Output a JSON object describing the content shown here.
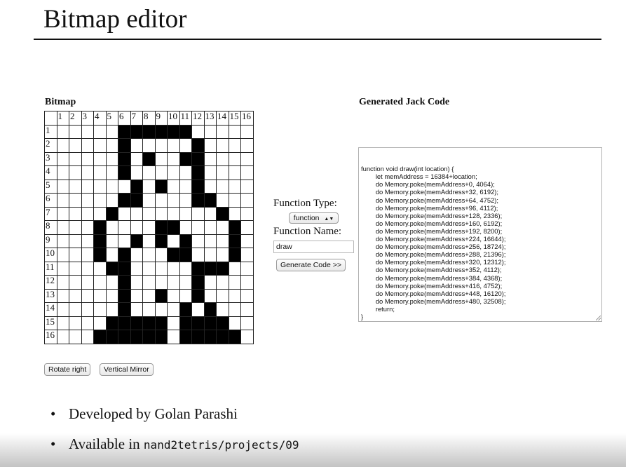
{
  "slide": {
    "title": "Bitmap editor"
  },
  "bitmap": {
    "label": "Bitmap",
    "column_headers": [
      "1",
      "2",
      "3",
      "4",
      "5",
      "6",
      "7",
      "8",
      "9",
      "10",
      "11",
      "12",
      "13",
      "14",
      "15",
      "16"
    ],
    "row_headers": [
      "1",
      "2",
      "3",
      "4",
      "5",
      "6",
      "7",
      "8",
      "9",
      "10",
      "11",
      "12",
      "13",
      "14",
      "15",
      "16"
    ],
    "rows": [
      "0000011111100000",
      "0000010000010000",
      "0000010100110000",
      "0000010000010000",
      "0000001010010000",
      "0000011000011000",
      "0000100000000100",
      "0001000011000010",
      "0001001010100010",
      "0001010001100010",
      "0000110000011100",
      "0000010000010000",
      "0000010010010000",
      "0000010000101000",
      "0000111110111100",
      "0001111110111110"
    ],
    "rotate_label": "Rotate right",
    "mirror_label": "Vertical Mirror"
  },
  "controls": {
    "function_type_label": "Function Type:",
    "function_type_value": "function",
    "function_name_label": "Function Name:",
    "function_name_value": "draw",
    "generate_label": "Generate Code >>"
  },
  "code": {
    "label": "Generated Jack Code",
    "lines": [
      "function void draw(int location) {",
      "\tlet memAddress = 16384+location;",
      "\tdo Memory.poke(memAddress+0, 4064);",
      "\tdo Memory.poke(memAddress+32, 6192);",
      "\tdo Memory.poke(memAddress+64, 4752);",
      "\tdo Memory.poke(memAddress+96, 4112);",
      "\tdo Memory.poke(memAddress+128, 2336);",
      "\tdo Memory.poke(memAddress+160, 6192);",
      "\tdo Memory.poke(memAddress+192, 8200);",
      "\tdo Memory.poke(memAddress+224, 16644);",
      "\tdo Memory.poke(memAddress+256, 18724);",
      "\tdo Memory.poke(memAddress+288, 21396);",
      "\tdo Memory.poke(memAddress+320, 12312);",
      "\tdo Memory.poke(memAddress+352, 4112);",
      "\tdo Memory.poke(memAddress+384, 4368);",
      "\tdo Memory.poke(memAddress+416, 4752);",
      "\tdo Memory.poke(memAddress+448, 16120);",
      "\tdo Memory.poke(memAddress+480, 32508);",
      "\treturn;",
      "}"
    ]
  },
  "bullets": {
    "item1": "Developed by Golan Parashi",
    "item2_prefix": "Available in ",
    "item2_code": "nand2tetris/projects/09",
    "marker": "•"
  }
}
